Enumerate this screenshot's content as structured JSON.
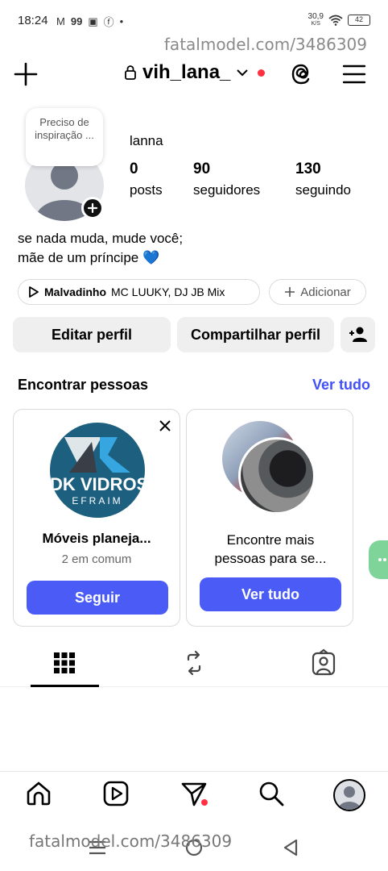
{
  "status_bar": {
    "time": "18:24",
    "app_icons": [
      "M",
      "99",
      "▣",
      "ⓕ",
      "•"
    ],
    "speed_value": "30,9",
    "speed_unit": "K/S",
    "battery": "42"
  },
  "watermark": {
    "text": "fatalmodel.com/3486309"
  },
  "header": {
    "username": "vih_lana_"
  },
  "profile": {
    "note": "Preciso de inspiração ...",
    "display_name": "lanna",
    "stats": [
      {
        "value": "0",
        "label": "posts"
      },
      {
        "value": "90",
        "label": "seguidores"
      },
      {
        "value": "130",
        "label": "seguindo"
      }
    ],
    "bio_line1": "se nada muda, mude você;",
    "bio_line2": "mãe de um príncipe 💙"
  },
  "music": {
    "song": "Malvadinho",
    "artist": "MC LUUKY, DJ JB Mix",
    "add_label": "Adicionar"
  },
  "actions": {
    "edit_label": "Editar perfil",
    "share_label": "Compartilhar perfil"
  },
  "suggestions": {
    "title": "Encontrar pessoas",
    "see_all": "Ver tudo",
    "cards": [
      {
        "logo_text_1": "DK VIDROS",
        "logo_text_2": "EFRAIM",
        "name": "Móveis planeja...",
        "mutual": "2 em comum",
        "button": "Seguir"
      },
      {
        "text": "Encontre mais pessoas para se...",
        "button": "Ver tudo"
      }
    ]
  },
  "colors": {
    "accent_blue": "#4a5cf5",
    "link_blue": "#4150f7",
    "notification_red": "#ff3040"
  }
}
